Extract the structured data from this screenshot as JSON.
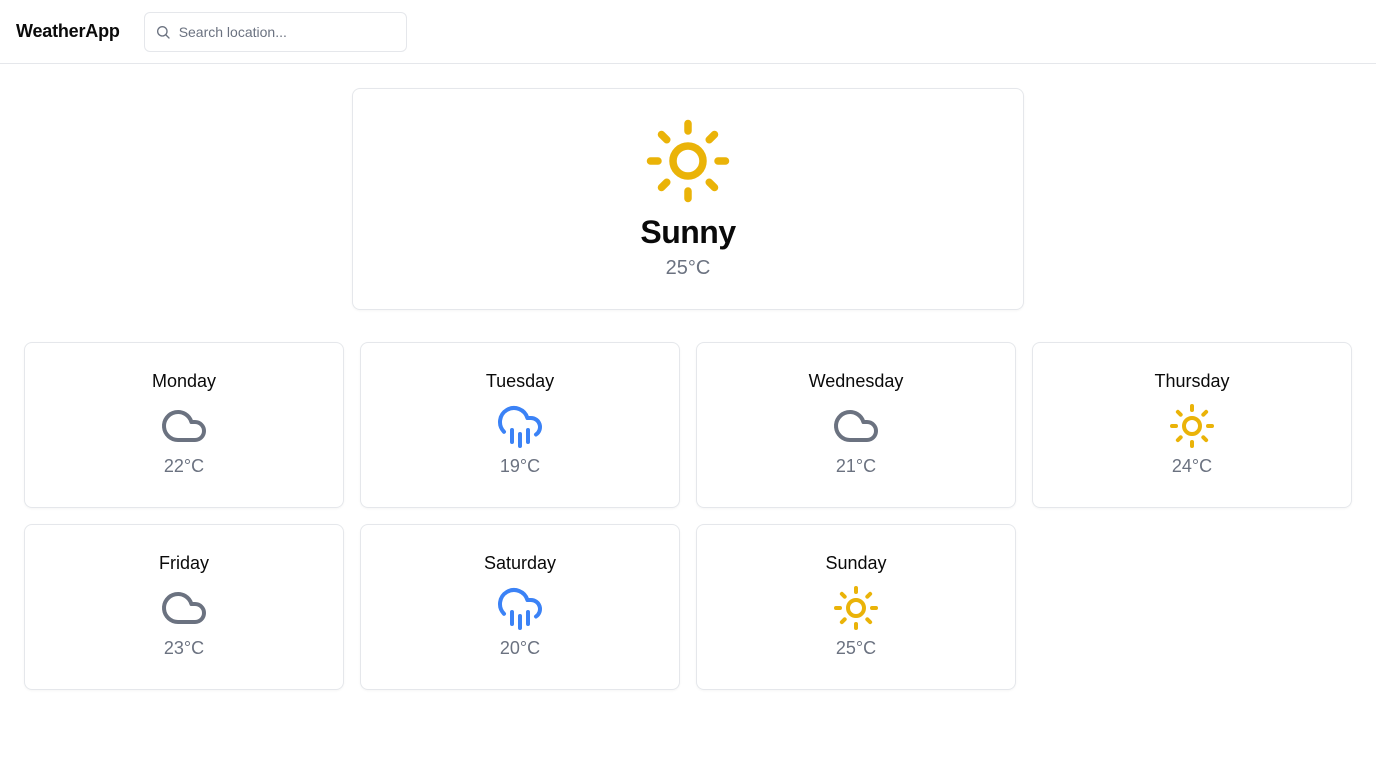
{
  "header": {
    "brand": "WeatherApp",
    "search_placeholder": "Search location...",
    "search_value": ""
  },
  "current": {
    "condition": "Sunny",
    "temperature": "25°C",
    "icon": "sun-icon"
  },
  "forecast": [
    {
      "day": "Monday",
      "temperature": "22°C",
      "icon": "cloud-icon"
    },
    {
      "day": "Tuesday",
      "temperature": "19°C",
      "icon": "rain-icon"
    },
    {
      "day": "Wednesday",
      "temperature": "21°C",
      "icon": "cloud-icon"
    },
    {
      "day": "Thursday",
      "temperature": "24°C",
      "icon": "sun-icon"
    },
    {
      "day": "Friday",
      "temperature": "23°C",
      "icon": "cloud-icon"
    },
    {
      "day": "Saturday",
      "temperature": "20°C",
      "icon": "rain-icon"
    },
    {
      "day": "Sunday",
      "temperature": "25°C",
      "icon": "sun-icon"
    }
  ],
  "colors": {
    "sun": "#eab308",
    "rain": "#3b82f6",
    "cloud": "#6b7280"
  }
}
